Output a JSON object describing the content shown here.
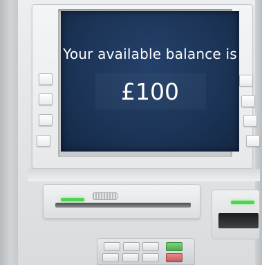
{
  "screen": {
    "title": "Your available balance is",
    "amount": "£100",
    "background_color": "#1c3558",
    "text_color": "#ffffff"
  },
  "indicators": {
    "card_reader_light_color": "#52d152",
    "receipt_light_color": "#52d152"
  },
  "keypad": {
    "function_key_colors": [
      "#4ea84e",
      "#cfb84a",
      "#c45a5a"
    ]
  }
}
